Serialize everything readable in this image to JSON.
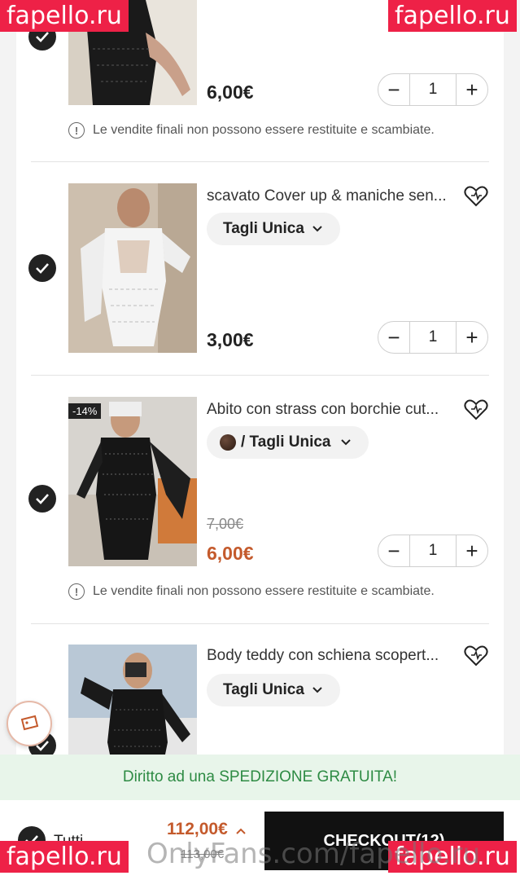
{
  "items": [
    {
      "price": "6,00€",
      "quantity": "1",
      "notice": "Le vendite finali non possono essere restituite e scambiate."
    },
    {
      "title": "scavato Cover up & maniche sen...",
      "size": "Tagli Unica",
      "price": "3,00€",
      "quantity": "1"
    },
    {
      "title": "Abito con strass con borchie cut...",
      "discount": "-14%",
      "size": "/ Tagli Unica",
      "old_price": "7,00€",
      "price": "6,00€",
      "quantity": "1",
      "notice": "Le vendite finali non possono essere restituite e scambiate."
    },
    {
      "title": "Body teddy con schiena scopert...",
      "size": "Tagli Unica"
    }
  ],
  "stepper": {
    "minus": "−",
    "plus": "+"
  },
  "shipping_banner": "Diritto ad una SPEDIZIONE GRATUITA!",
  "bottom": {
    "select_all": "Tutti",
    "total": "112,00€",
    "total_old": "113,00€",
    "checkout": "CHECKOUT(12)"
  },
  "watermark": {
    "badge": "fapello.ru",
    "text": "OnlyFans.com/fapello.ru"
  },
  "colors": {
    "sale": "#c45a2c",
    "shipping": "#2e8b44",
    "watermark": "#ee2147"
  }
}
